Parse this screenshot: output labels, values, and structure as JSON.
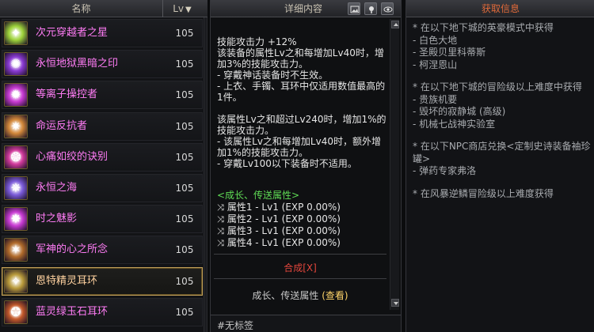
{
  "list": {
    "header": {
      "name": "名称",
      "lv": "Lv",
      "sort_icon": "triangle-down"
    },
    "items": [
      {
        "name": "次元穿越者之星",
        "lv": "105",
        "icon_color": "#9dd23a",
        "selected": false
      },
      {
        "name": "永恒地狱黑暗之印",
        "lv": "105",
        "icon_color": "#8a3ad2",
        "selected": false
      },
      {
        "name": "等离子操控者",
        "lv": "105",
        "icon_color": "#c83ad2",
        "selected": false
      },
      {
        "name": "命运反抗者",
        "lv": "105",
        "icon_color": "#d2883a",
        "selected": false
      },
      {
        "name": "心痛如绞的诀别",
        "lv": "105",
        "icon_color": "#d23a9c",
        "selected": false
      },
      {
        "name": "永恒之海",
        "lv": "105",
        "icon_color": "#7a5ad8",
        "selected": false
      },
      {
        "name": "时之魅影",
        "lv": "105",
        "icon_color": "#c73ad2",
        "selected": false
      },
      {
        "name": "军神的心之所念",
        "lv": "105",
        "icon_color": "#b06a2a",
        "selected": false
      },
      {
        "name": "恩特精灵耳环",
        "lv": "105",
        "icon_color": "#b89a3a",
        "selected": true
      },
      {
        "name": "蓝灵绿玉石耳环",
        "lv": "105",
        "icon_color": "#c45a2a",
        "selected": false
      }
    ]
  },
  "detail": {
    "title": "详细内容",
    "toolbar": [
      "image-icon",
      "pin-icon",
      "eye-icon"
    ],
    "desc_lines": [
      "技能攻击力 +12%",
      "该装备的属性Lv之和每增加Lv40时，增加3%的技能攻击力。",
      "- 穿戴神话装备时不生效。",
      "- 上衣、手镯、耳环中仅适用数值最高的1件。",
      "",
      "该属性Lv之和超过Lv240时，增加1%的技能攻击力。",
      "- 该属性Lv之和每增加Lv40时，额外增加1%的技能攻击力。",
      "- 穿戴Lv100以下装备时不适用。"
    ],
    "growth_title": "<成长、传送属性>",
    "attributes": [
      "属性1 - Lv1 (EXP 0.00%)",
      "属性2 - Lv1 (EXP 0.00%)",
      "属性3 - Lv1 (EXP 0.00%)",
      "属性4 - Lv1 (EXP 0.00%)"
    ],
    "synth": "合成[X]",
    "bottom_prefix": "成长、传送属性",
    "bottom_link": "(查看)",
    "tag": "#无标签"
  },
  "source": {
    "title": "获取信息",
    "lines": [
      "* 在以下地下城的英豪模式中获得",
      "- 白色大地",
      "- 圣殿贝里科蒂斯",
      "- 柯涅恩山",
      "",
      "* 在以下地下城的冒险级以上难度中获得",
      "- 贵族机要",
      "- 毁坏的寂静城 (高级)",
      "- 机械七战神实验室",
      "",
      "* 在以下NPC商店兑换<定制史诗装备袖珍罐>",
      "- 弹药专家弗洛",
      "",
      "* 在风暴逆鳞冒险级以上难度获得"
    ]
  }
}
